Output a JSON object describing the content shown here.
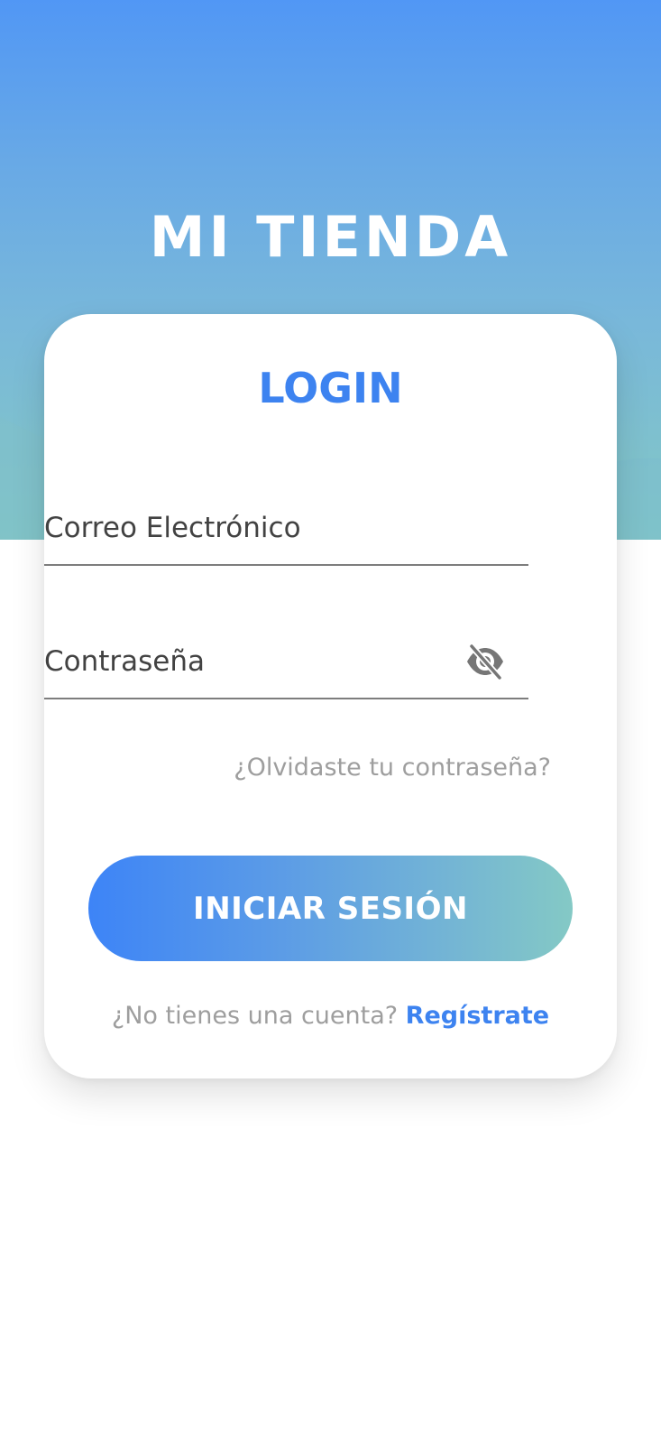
{
  "header": {
    "app_title": "MI TIENDA"
  },
  "login_card": {
    "title": "LOGIN",
    "email_field": {
      "placeholder": "Correo Electrónico",
      "value": ""
    },
    "password_field": {
      "placeholder": "Contraseña",
      "value": "",
      "visibility_icon": "eye-off-icon"
    },
    "forgot_password_link": "¿Olvidaste tu contraseña?",
    "submit_button": "INICIAR SESIÓN",
    "signup_prompt": "¿No tienes una cuenta?",
    "signup_link": "Regístrate"
  },
  "colors": {
    "accent": "#3d83f0",
    "gradient_start": "#3d84f7",
    "gradient_end": "#84c9c5",
    "muted_text": "#9e9e9e"
  }
}
